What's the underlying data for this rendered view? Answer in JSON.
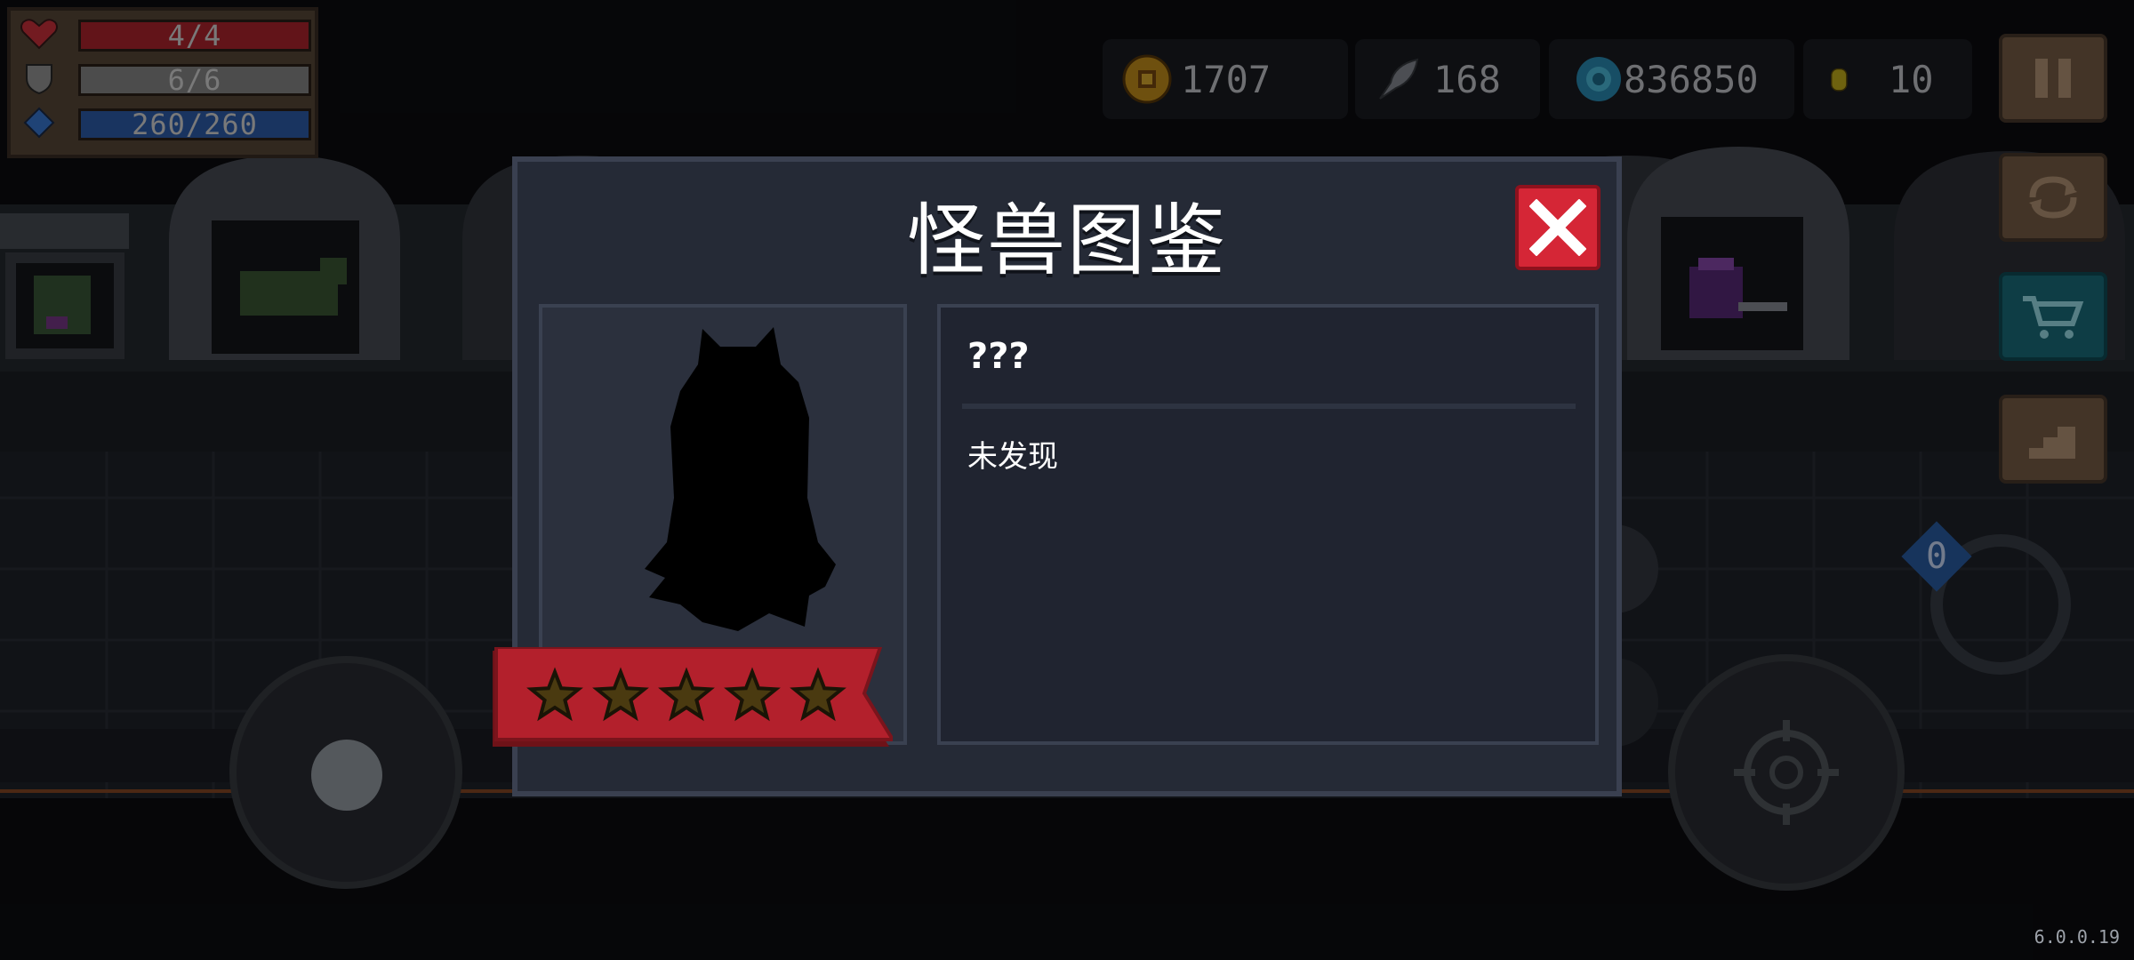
{
  "hud": {
    "hp": "4/4",
    "armor": "6/6",
    "energy": "260/260"
  },
  "currencies": [
    {
      "icon": "gold-coin-icon",
      "value": "1707"
    },
    {
      "icon": "fish-icon",
      "value": "168"
    },
    {
      "icon": "gem-icon",
      "value": "836850"
    },
    {
      "icon": "token-icon",
      "value": "10"
    }
  ],
  "modal": {
    "title": "怪兽图鉴",
    "monster_name": "???",
    "description": "未发现",
    "stars": 5
  },
  "version": "6.0.0.19",
  "aim_counter": "0",
  "colors": {
    "hp_bar": "#b3262f",
    "energy_bar": "#2f5fb0",
    "close_button": "#d52636",
    "ribbon": "#b3202c",
    "shop_button": "#1a6f7e"
  }
}
